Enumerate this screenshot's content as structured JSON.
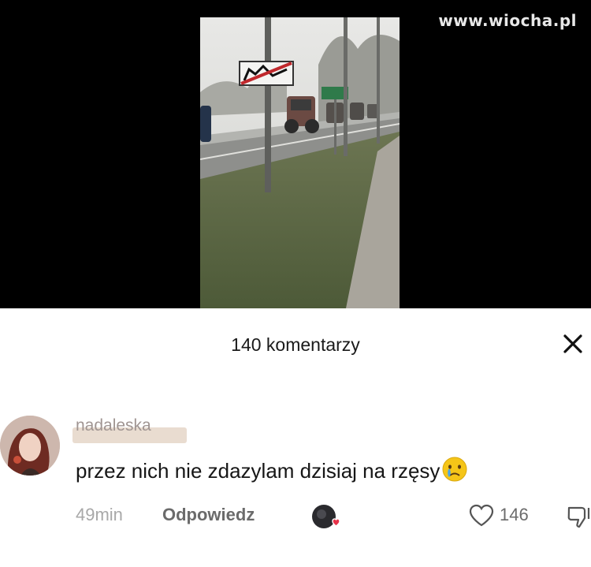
{
  "watermark": "www.wiocha.pl",
  "comments": {
    "count_label": "140 komentarzy",
    "close_glyph": "✕"
  },
  "comment": {
    "username": "nadaleska",
    "text": "przez nich nie zdazylam dzisiaj na rzęsy",
    "emoji": "crying-smiley-icon",
    "time": "49min",
    "reply_label": "Odpowiedz",
    "like_count": "146"
  },
  "colors": {
    "background": "#ffffff",
    "video_background": "#000000",
    "primary_text": "#161616",
    "secondary_text": "#a8a8a8",
    "creator_like_heart": "#e8334a"
  }
}
